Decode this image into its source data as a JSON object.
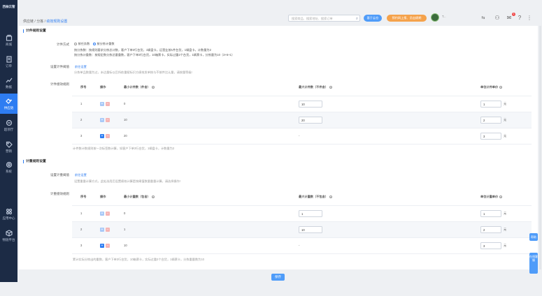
{
  "brand": "西柚云管",
  "sidebar": {
    "items": [
      {
        "label": "商城",
        "icon": "store-icon",
        "active": false
      },
      {
        "label": "订单",
        "icon": "order-icon",
        "active": false
      },
      {
        "label": "数据",
        "icon": "chart-icon",
        "active": false
      },
      {
        "label": "供应链",
        "icon": "supply-chain-icon",
        "active": true
      },
      {
        "label": "超领厅",
        "icon": "hall-icon",
        "active": false
      },
      {
        "label": "营销",
        "icon": "tag-icon",
        "active": false
      },
      {
        "label": "系统",
        "icon": "gear-icon",
        "active": false
      }
    ],
    "bottom": [
      {
        "label": "应用中心",
        "icon": "apps-icon"
      },
      {
        "label": "物链平台",
        "icon": "cube-icon"
      }
    ]
  },
  "breadcrumb": {
    "items": [
      "供应链",
      "分拣"
    ],
    "current": "绩效规则设置"
  },
  "header": {
    "search_placeholder": "搜索商品、搜索地址、搜索订单",
    "btn_blue": "基于云仓",
    "btn_orange": "预约网上报、员出绩期",
    "user": "T...",
    "badge_count": "1"
  },
  "piece": {
    "title": "计件规则设置",
    "method_label": "计件方式",
    "method_options": [
      "按任务数",
      "按分拣计重数"
    ],
    "method_selected": 1,
    "desc1": "按分拣数：按规则要求分拣总计数，客户下单3行台货，1辆盘卡，运营业按1件台货，1辆盘卡，计数量为2",
    "desc2": "按分拣计重数：按规定数分拣总量重数，客户下单3行台货，10箱票卡，实际过重2个台货，1辆票卡，分拣量为10（3+6+1）",
    "threshold_label": "设置计件阈值",
    "threshold_link": "前往设置",
    "threshold_note": "分拣单品数量为过，未达量标以后所依重赋标识方绩效发单按与不按件比认量，请按量等级!",
    "rule_label": "计件绩效规则",
    "columns": [
      "序号",
      "操作",
      "最小计件数（件含）",
      "最大计件数（不件含）",
      "单位计件单价"
    ],
    "rows": [
      {
        "no": "1",
        "min": "0",
        "max": "10",
        "price": "1",
        "unit": "元"
      },
      {
        "no": "2",
        "min": "10",
        "max": "20",
        "price": "2",
        "unit": "元"
      },
      {
        "no": "3",
        "min": "20",
        "max": "-",
        "price": "3",
        "unit": "元"
      }
    ],
    "footnote": "计件数计数规则按一次标签数计算，如客户下单3行台货，1辆盘卡，计数量为2"
  },
  "weight": {
    "title": "计重规则设置",
    "threshold_label": "设置计重阈值",
    "threshold_link": "前往设置",
    "threshold_note": "设置重量计算方式，此处选用后设置绩效计算是按阈值数量重量计算，请选择操作!",
    "rule_label": "计重绩效规则",
    "columns": [
      "序号",
      "操作",
      "最小计重数（包含）",
      "最大计重数（不包含）",
      "单位计重单价"
    ],
    "rows": [
      {
        "no": "1",
        "min": "0",
        "max": "1",
        "price": "1",
        "unit": "元"
      },
      {
        "no": "2",
        "min": "1",
        "max": "10",
        "price": "2",
        "unit": "元"
      },
      {
        "no": "3",
        "min": "10",
        "max": "-",
        "price": "3",
        "unit": "元"
      }
    ],
    "footnote": "累计实际分拣出的重数，客户下单3行台货，10箱票卡，实际过重2个台货，1辆票卡，分拣重量数为10"
  },
  "save_label": "保存",
  "float": {
    "help": "帮助",
    "service": "在线客服"
  }
}
